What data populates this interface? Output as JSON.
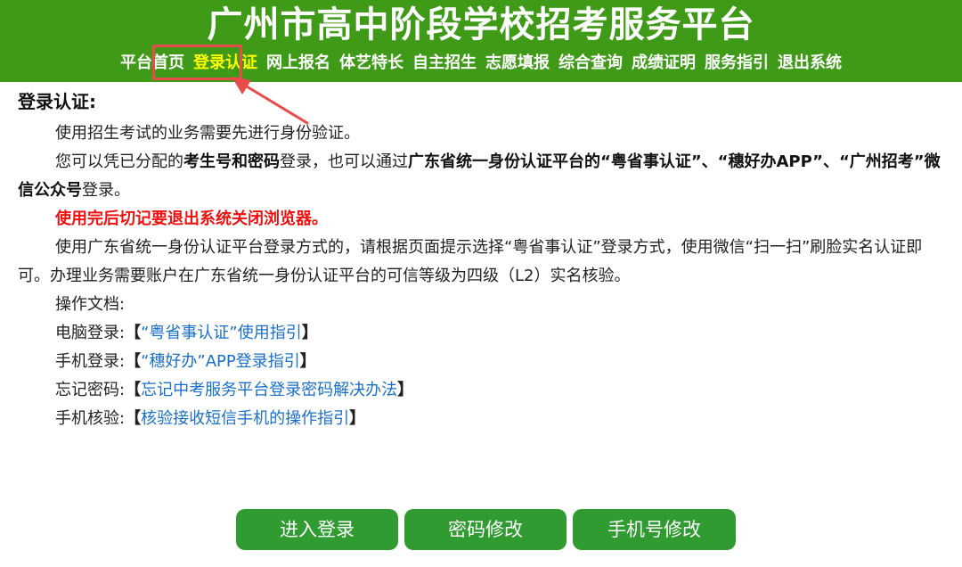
{
  "header": {
    "title": "广州市高中阶段学校招考服务平台",
    "nav": [
      {
        "label": "平台首页"
      },
      {
        "label": "登录认证"
      },
      {
        "label": "网上报名"
      },
      {
        "label": "体艺特长"
      },
      {
        "label": "自主招生"
      },
      {
        "label": "志愿填报"
      },
      {
        "label": "综合查询"
      },
      {
        "label": "成绩证明"
      },
      {
        "label": "服务指引"
      },
      {
        "label": "退出系统"
      }
    ],
    "active_nav": "登录认证"
  },
  "content": {
    "title": "登录认证:",
    "para1": "使用招生考试的业务需要先进行身份验证。",
    "para2_a": "您可以凭已分配的",
    "para2_b": "考生号和密码",
    "para2_c": "登录，也可以通过",
    "para2_d": "广东省统一身份认证平台的“粤省事认证”、“穗好办APP”、“广州招考”微信公众号",
    "para2_e": "登录。",
    "warning": "使用完后切记要退出系统关闭浏览器。",
    "para3": "使用广东省统一身份认证平台登录方式的，请根据页面提示选择“粤省事认证”登录方式，使用微信“扫一扫”刷脸实名认证即可。办理业务需要账户在广东省统一身份认证平台的可信等级为四级（L2）实名核验。",
    "docs_label": "操作文档:",
    "docs": [
      {
        "label": "电脑登录:",
        "link": "“粤省事认证”使用指引"
      },
      {
        "label": "手机登录:",
        "link": "“穗好办”APP登录指引"
      },
      {
        "label": "忘记密码:",
        "link": "忘记中考服务平台登录密码解决办法"
      },
      {
        "label": "手机核验:",
        "link": "核验接收短信手机的操作指引"
      }
    ],
    "bracket_open": "【",
    "bracket_close": "】"
  },
  "buttons": {
    "login": "进入登录",
    "change_password": "密码修改",
    "change_phone": "手机号修改"
  },
  "colors": {
    "header_bg": "#3f9a18",
    "active_nav": "#ffff00",
    "highlight": "#e94b4b",
    "warning": "#ee1111",
    "link": "#1a6fc9",
    "button_bg": "#2f9b31"
  }
}
